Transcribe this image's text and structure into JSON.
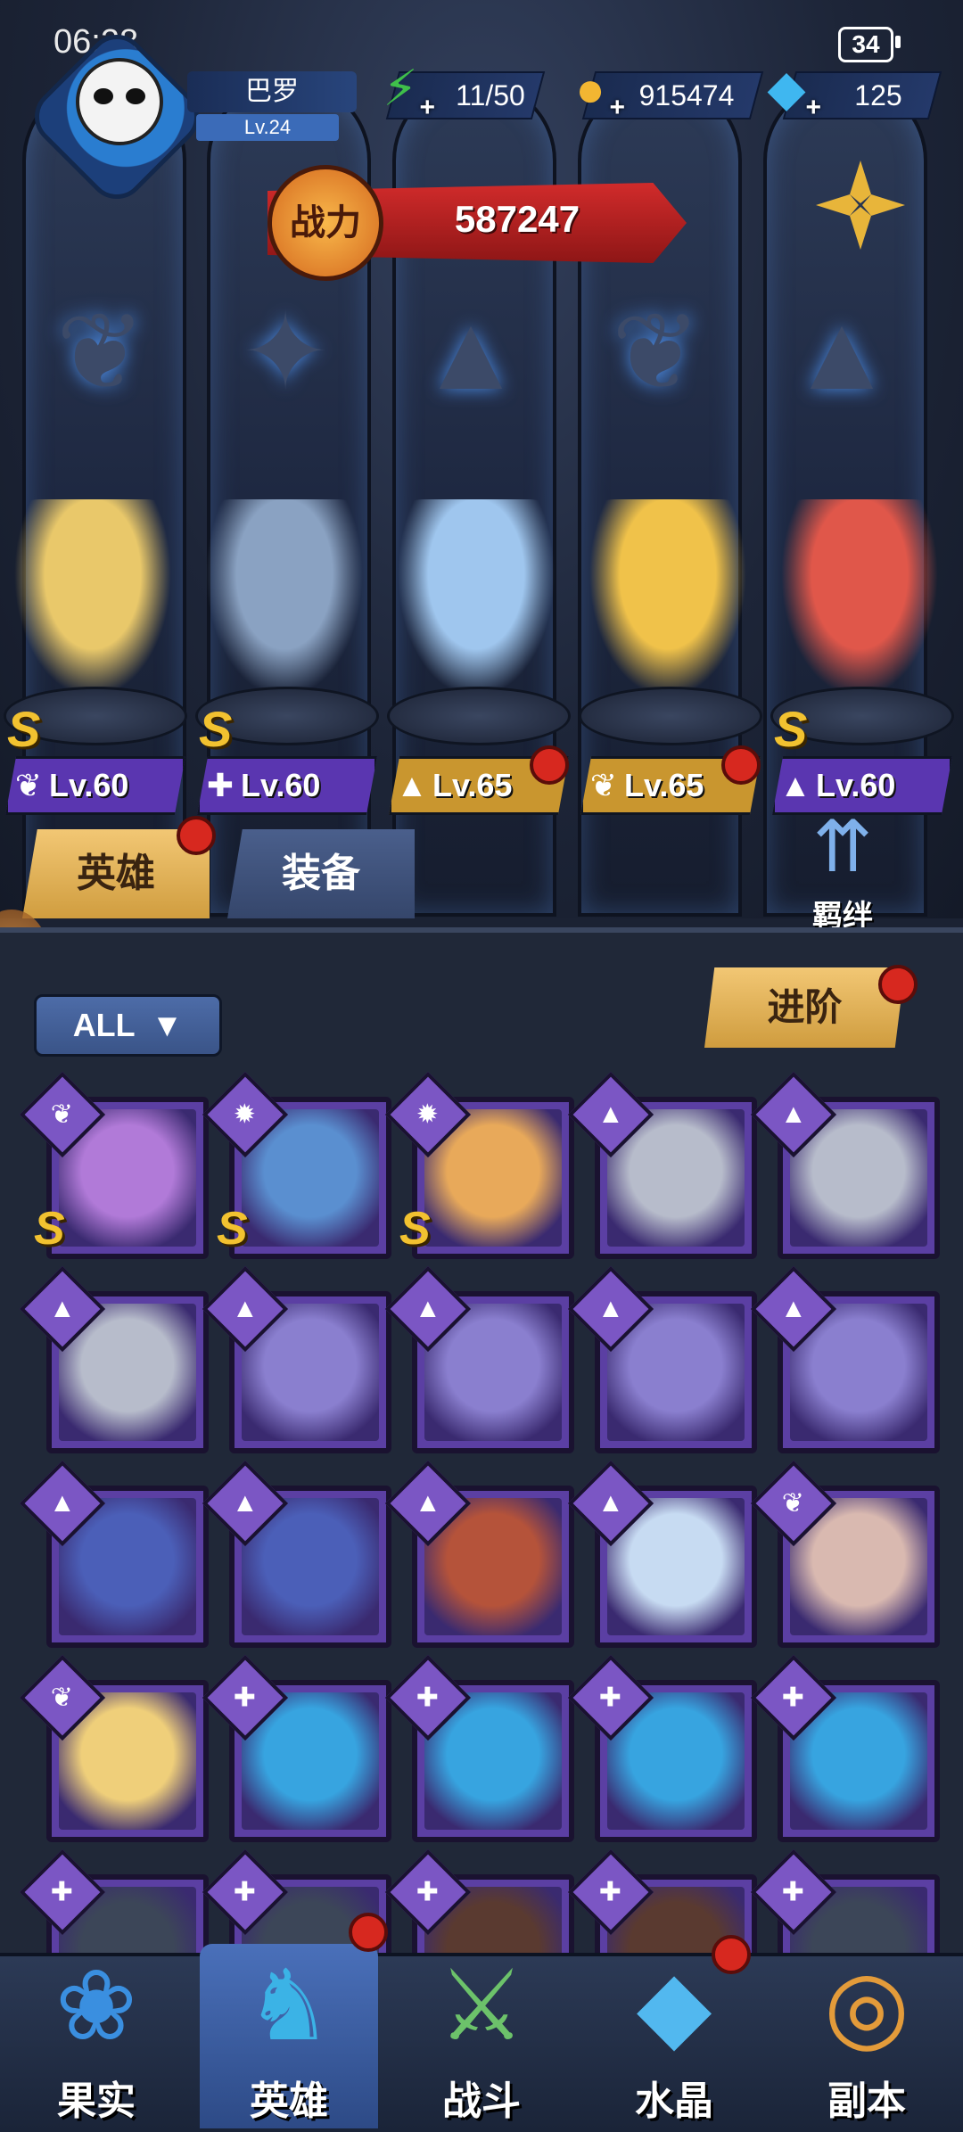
{
  "status_bar": {
    "time": "06:28",
    "battery": "34"
  },
  "player": {
    "name": "巴罗",
    "level": "Lv.24"
  },
  "resources": [
    {
      "name": "stamina",
      "icon": "lightning-icon",
      "value": "11/50",
      "color": "#3fbf4a"
    },
    {
      "name": "gold",
      "icon": "coin-icon",
      "value": "915474",
      "color": "#f2b632"
    },
    {
      "name": "diamond",
      "icon": "diamond-icon",
      "value": "125",
      "color": "#3fb7f0"
    }
  ],
  "power": {
    "label": "战力",
    "value": "587247"
  },
  "team": [
    {
      "class_icon": "wing-icon",
      "level": "Lv.60",
      "rank": "S",
      "plate_color": "#5a36b0",
      "red_dot": false,
      "color": "#e9c86a"
    },
    {
      "class_icon": "wrench-icon",
      "level": "Lv.60",
      "rank": "S",
      "plate_color": "#5a36b0",
      "red_dot": false,
      "color": "#8aa2c2"
    },
    {
      "class_icon": "hat-icon",
      "level": "Lv.65",
      "rank": "",
      "plate_color": "#c9962f",
      "red_dot": true,
      "color": "#9fc6ee"
    },
    {
      "class_icon": "wing-icon",
      "level": "Lv.65",
      "rank": "",
      "plate_color": "#c9962f",
      "red_dot": true,
      "color": "#f0c24a"
    },
    {
      "class_icon": "hat-icon",
      "level": "Lv.60",
      "rank": "S",
      "plate_color": "#5a36b0",
      "red_dot": false,
      "color": "#e0574a"
    }
  ],
  "tabs": {
    "hero": "英雄",
    "equipment": "装备"
  },
  "bond": {
    "label": "羁绊"
  },
  "filter": {
    "label": "ALL"
  },
  "advance": {
    "label": "进阶"
  },
  "hero_cards": [
    {
      "class_icon": "wing-icon",
      "rank": "S",
      "color": "#b17ad8"
    },
    {
      "class_icon": "beast-icon",
      "rank": "S",
      "color": "#5a8fd0"
    },
    {
      "class_icon": "beast-icon",
      "rank": "S",
      "color": "#e8a95a"
    },
    {
      "class_icon": "hat-icon",
      "rank": "",
      "color": "#b7bccb"
    },
    {
      "class_icon": "hat-icon",
      "rank": "",
      "color": "#b7bccb"
    },
    {
      "class_icon": "hat-icon",
      "rank": "",
      "color": "#b7bccb"
    },
    {
      "class_icon": "hat-icon",
      "rank": "",
      "color": "#8a7fcf"
    },
    {
      "class_icon": "hat-icon",
      "rank": "",
      "color": "#8a7fcf"
    },
    {
      "class_icon": "hat-icon",
      "rank": "",
      "color": "#8a7fcf"
    },
    {
      "class_icon": "hat-icon",
      "rank": "",
      "color": "#8a7fcf"
    },
    {
      "class_icon": "hat-icon",
      "rank": "",
      "color": "#4b5fb8"
    },
    {
      "class_icon": "hat-icon",
      "rank": "",
      "color": "#4b5fb8"
    },
    {
      "class_icon": "hat-icon",
      "rank": "",
      "color": "#b5533a"
    },
    {
      "class_icon": "hat-icon",
      "rank": "",
      "color": "#c7dbf2"
    },
    {
      "class_icon": "wing-icon",
      "rank": "",
      "color": "#d9b9b0"
    },
    {
      "class_icon": "wing-icon",
      "rank": "",
      "color": "#efcf7a"
    },
    {
      "class_icon": "wrench-icon",
      "rank": "",
      "color": "#37a4e0"
    },
    {
      "class_icon": "wrench-icon",
      "rank": "",
      "color": "#37a4e0"
    },
    {
      "class_icon": "wrench-icon",
      "rank": "",
      "color": "#37a4e0"
    },
    {
      "class_icon": "wrench-icon",
      "rank": "",
      "color": "#37a4e0"
    },
    {
      "class_icon": "wrench-icon",
      "rank": "",
      "color": "#3c4658"
    },
    {
      "class_icon": "wrench-icon",
      "rank": "",
      "color": "#3c4658"
    },
    {
      "class_icon": "wrench-icon",
      "rank": "",
      "color": "#5a3a30"
    },
    {
      "class_icon": "wrench-icon",
      "rank": "",
      "color": "#5a3a30"
    },
    {
      "class_icon": "wrench-icon",
      "rank": "",
      "color": "#3c4658"
    }
  ],
  "bottom_nav": [
    {
      "label": "果实",
      "icon": "fruit-icon",
      "active": false
    },
    {
      "label": "英雄",
      "icon": "hero-hat-icon",
      "active": true
    },
    {
      "label": "战斗",
      "icon": "battle-book-icon",
      "active": false
    },
    {
      "label": "水晶",
      "icon": "crystal-icon",
      "active": false
    },
    {
      "label": "副本",
      "icon": "dungeon-portal-icon",
      "active": false
    }
  ]
}
